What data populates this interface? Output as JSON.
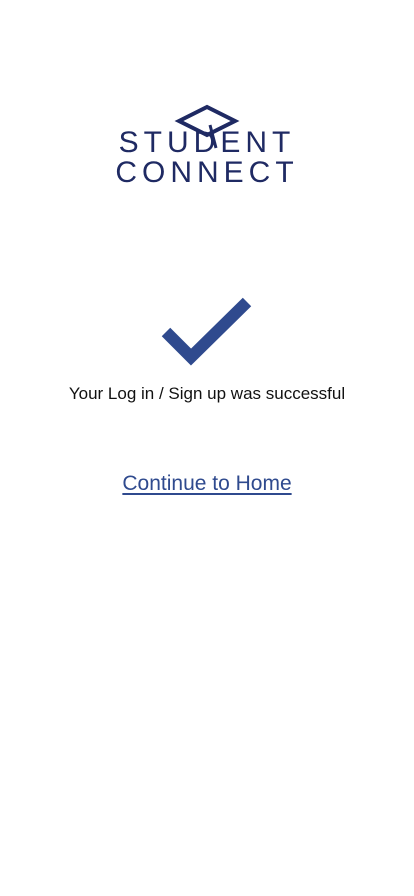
{
  "brand": {
    "line1": "STUDENT",
    "line2": "CONNECT",
    "logo_color": "#1f2a63",
    "icon": "graduation-cap-icon"
  },
  "status": {
    "icon": "checkmark-icon",
    "icon_color": "#2f4a8e",
    "message": "Your Log in / Sign up was successful"
  },
  "actions": {
    "continue_label": "Continue to Home",
    "link_color": "#2f4a8e"
  }
}
